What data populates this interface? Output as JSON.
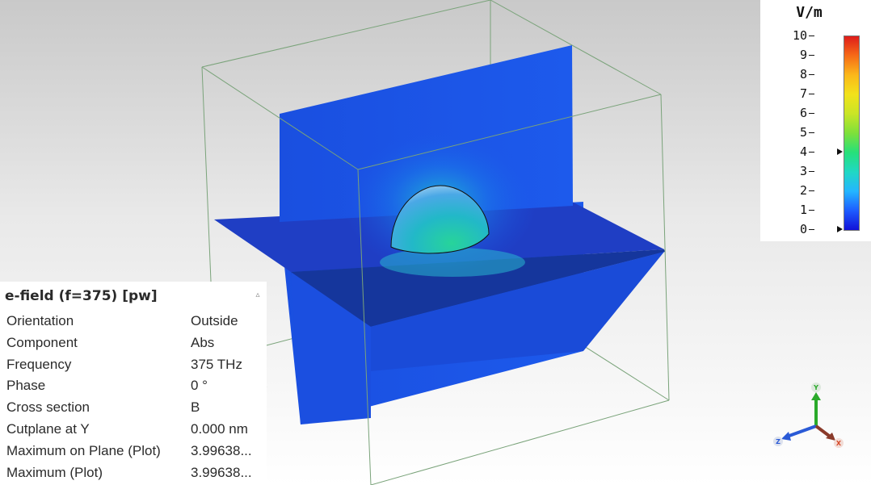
{
  "legend": {
    "unit": "V/m",
    "ticks": [
      "10",
      "9",
      "8",
      "7",
      "6",
      "5",
      "4",
      "3",
      "2",
      "1",
      "0"
    ],
    "scale_min": 0,
    "scale_max": 10,
    "marker_values": [
      4,
      0
    ]
  },
  "properties": {
    "title": "e-field (f=375) [pw]",
    "collapse_glyph": "▵",
    "rows": [
      {
        "key": "Orientation",
        "value": "Outside"
      },
      {
        "key": "Component",
        "value": "Abs"
      },
      {
        "key": "Frequency",
        "value": "375 THz"
      },
      {
        "key": "Phase",
        "value": "0 °"
      },
      {
        "key": "Cross section",
        "value": "B"
      },
      {
        "key": "Cutplane at Y",
        "value": "0.000 nm"
      },
      {
        "key": "Maximum on Plane (Plot)",
        "value": "3.99638..."
      },
      {
        "key": "Maximum (Plot)",
        "value": "3.99638..."
      }
    ]
  },
  "axes": {
    "y_label": "Y",
    "x_label": "X",
    "z_label": "Z"
  },
  "colors": {
    "plane_blue": "#1a52e8",
    "field_max": "#27d49a",
    "axis_x": "#d64a2a",
    "axis_y": "#2aaa2a",
    "axis_z": "#2a5ad6"
  }
}
